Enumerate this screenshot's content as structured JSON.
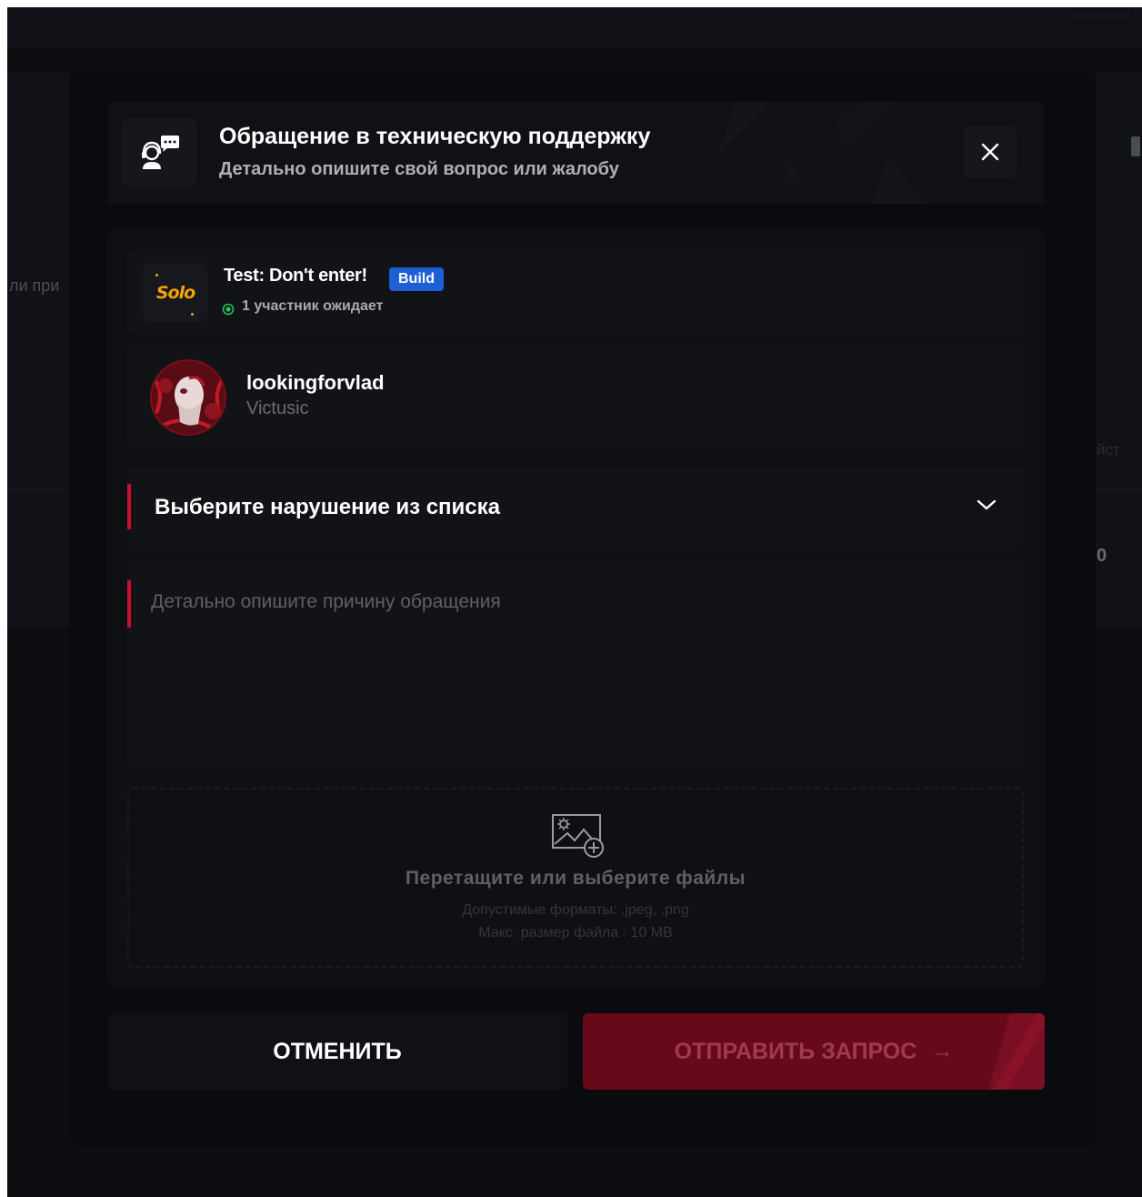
{
  "background": {
    "left_text": "ли при",
    "right_text": "йст",
    "right_number": "0"
  },
  "modal": {
    "title": "Обращение в техническую поддержку",
    "subtitle": "Детально опишите свой вопрос или жалобу",
    "header_icon": "support-chat-icon",
    "close_icon": "close-icon"
  },
  "match": {
    "logo_text": "Solo",
    "title": "Test: Don't enter!",
    "badge": "Build",
    "status": "1 участник ожидает"
  },
  "player": {
    "name": "lookingforvlad",
    "team": "Victusic"
  },
  "violation_select": {
    "placeholder": "Выберите нарушение из списка"
  },
  "description": {
    "placeholder": "Детально опишите причину обращения"
  },
  "upload": {
    "title": "Перетащите или выберите файлы",
    "formats": "Допустимые форматы: .jpeg, .png",
    "max_size": "Макс. размер файла : 10 MB"
  },
  "buttons": {
    "cancel": "ОТМЕНИТЬ",
    "submit": "ОТПРАВИТЬ ЗАПРОС",
    "submit_arrow": "→"
  },
  "colors": {
    "accent": "#c8102e",
    "submit_bg": "#660a1a",
    "badge": "#1f5fd6",
    "status_online": "#22c55e",
    "solo_logo": "#f5a300"
  }
}
